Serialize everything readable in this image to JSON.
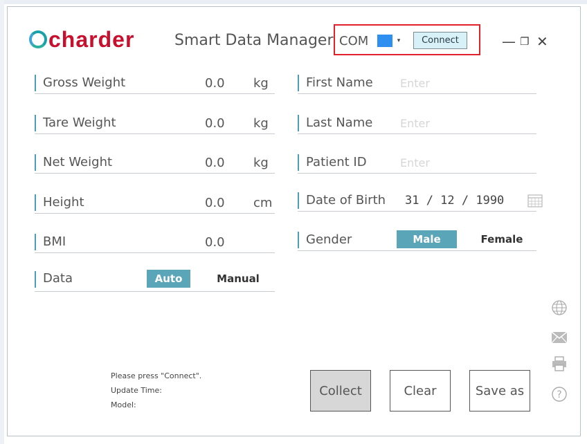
{
  "header": {
    "logo_text": "charder",
    "title": "Smart Data Manager",
    "com_label": "COM",
    "connect_label": "Connect",
    "minimize_glyph": "—",
    "restore_glyph": "❐",
    "close_glyph": "✕"
  },
  "left_fields": [
    {
      "label": "Gross Weight",
      "value": "0.0",
      "unit": "kg"
    },
    {
      "label": "Tare Weight",
      "value": "0.0",
      "unit": "kg"
    },
    {
      "label": "Net Weight",
      "value": "0.0",
      "unit": "kg"
    },
    {
      "label": "Height",
      "value": "0.0",
      "unit": "cm"
    },
    {
      "label": "BMI",
      "value": "0.0",
      "unit": ""
    }
  ],
  "data_mode": {
    "label": "Data",
    "auto": "Auto",
    "manual": "Manual",
    "selected": "Auto"
  },
  "right_fields": {
    "first_name": {
      "label": "First Name",
      "placeholder": "Enter"
    },
    "last_name": {
      "label": "Last Name",
      "placeholder": "Enter"
    },
    "patient_id": {
      "label": "Patient ID",
      "placeholder": "Enter"
    },
    "dob": {
      "label": "Date of Birth",
      "value": "31 / 12 / 1990"
    },
    "gender": {
      "label": "Gender",
      "male": "Male",
      "female": "Female",
      "selected": "Male"
    }
  },
  "status": {
    "message": "Please press \"Connect\".",
    "update_time": "Update Time:",
    "model": "Model:"
  },
  "buttons": {
    "collect": "Collect",
    "clear": "Clear",
    "save_as": "Save as"
  },
  "side_icons": [
    "globe-icon",
    "mail-icon",
    "printer-icon",
    "help-icon"
  ],
  "colors": {
    "accent": "#5aa5b8",
    "logo_red": "#c8102e",
    "highlight_box": "#e0202a"
  }
}
